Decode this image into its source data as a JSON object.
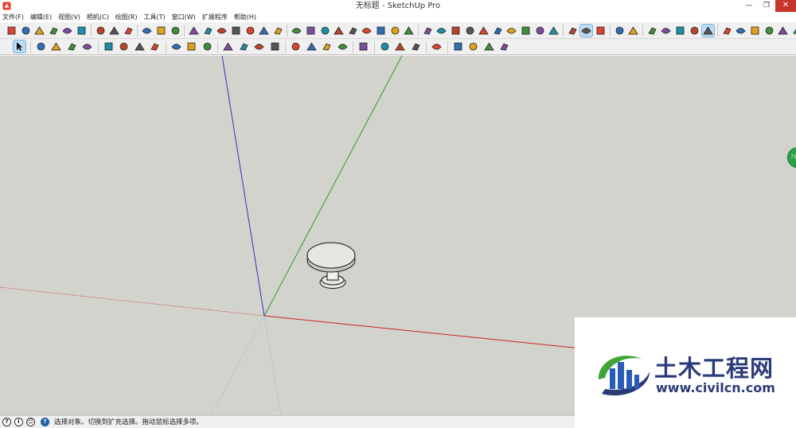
{
  "window": {
    "title": "无标题 - SketchUp Pro",
    "minimize_glyph": "—",
    "restore_glyph": "❐",
    "close_glyph": "✕"
  },
  "menu": [
    "文件(F)",
    "编辑(E)",
    "视图(V)",
    "相机(C)",
    "绘图(R)",
    "工具(T)",
    "窗口(W)",
    "扩展程序",
    "帮助(H)"
  ],
  "toolbar_row1": {
    "groups": [
      [
        "warehouse-icon",
        "component-icon",
        "house-icon",
        "garage-icon",
        "house-outline-icon",
        "shed-icon"
      ],
      [
        "sphere-icon",
        "hat-icon",
        "flag-icon"
      ],
      [
        "dome-icon",
        "ball-icon",
        "pin-icon"
      ],
      [
        "push-tool-icon",
        "move-face-icon",
        "offset-icon",
        "extrude-icon",
        "grid-icon",
        "stair-icon",
        "fold-icon"
      ],
      [
        "cut-icon",
        "curve-icon",
        "check-curve-icon",
        "arc-edge-icon",
        "eraser-shape-icon",
        "flag-red-icon",
        "weld-icon",
        "bend-icon",
        "flag-small-icon"
      ],
      [
        "box-icon",
        "slice-icon",
        "joint-icon",
        "bowl-icon",
        "cube-icon",
        "panel-icon",
        "stretch-icon",
        "copy-icon",
        "brush-icon",
        "clean-icon"
      ],
      [
        "eye-icon",
        "sandbox-icon",
        "ruby-icon"
      ],
      [
        "layer-icon",
        "layers-icon"
      ],
      [
        "book-icon",
        "square-outline-icon",
        "tag-icon",
        "stack-icon",
        "stack-blue-icon"
      ],
      [
        "gold-icon",
        "gem-icon",
        "r-icon",
        "globe-icon",
        "rb-icon",
        "rt-icon",
        "rw-icon",
        "blue-ball-icon"
      ]
    ],
    "active": [
      "sandbox-icon",
      "stack-blue-icon"
    ]
  },
  "toolbar_row2": {
    "groups": [
      [
        "select-arrow-icon"
      ],
      [
        "eraser-icon",
        "pencil-icon",
        "arc-icon",
        "shape-icon"
      ],
      [
        "push-pull-icon",
        "move-icon",
        "rotate-icon",
        "scale-icon"
      ],
      [
        "tape-measure-icon",
        "text-icon",
        "paint-bucket-icon"
      ],
      [
        "orbit-icon",
        "pan-icon",
        "zoom-icon",
        "zoom-extents-icon"
      ],
      [
        "warehouse-book-icon",
        "share-component-icon",
        "extension-icon",
        "ruby-console-icon"
      ],
      [
        "section-plane-icon"
      ],
      [
        "line-path-icon",
        "curve-path-icon",
        "path-icon"
      ],
      [
        "wave-icon"
      ],
      [
        "axis-a-icon",
        "axis-b-icon",
        "axis-c-icon",
        "axis-d-icon"
      ]
    ],
    "active": [
      "select-arrow-icon"
    ]
  },
  "viewport": {
    "background": "#d3d3cd",
    "axis_colors": {
      "red": "#c7261f",
      "green": "#2e9c2b",
      "blue": "#3232c0"
    },
    "side_badge": "71"
  },
  "statusbar": {
    "text": "选择对象。切换到扩充选择。拖动鼠标选择多项。"
  },
  "watermark": {
    "name": "土木工程网",
    "url": "www.civilcn.com"
  }
}
